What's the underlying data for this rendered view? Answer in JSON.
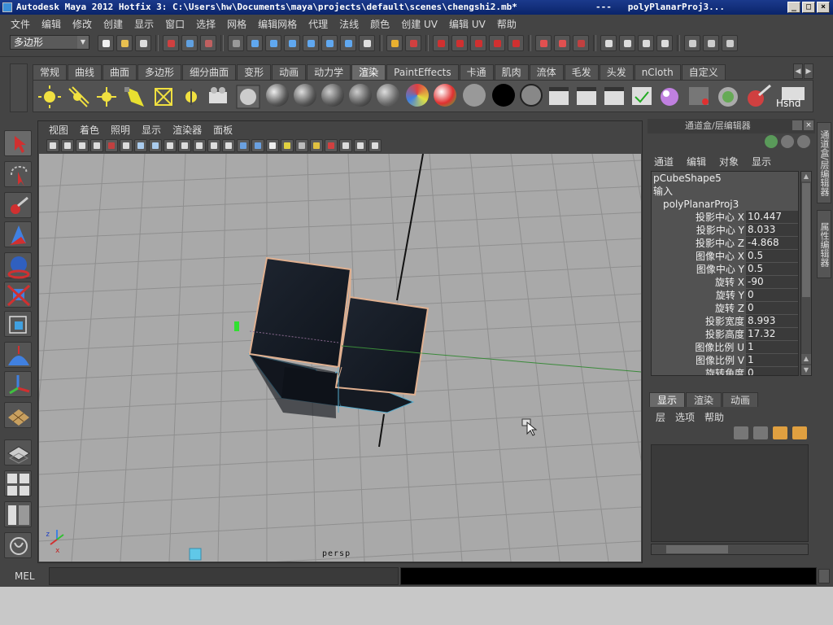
{
  "window": {
    "title": "Autodesk Maya 2012 Hotfix 3: C:\\Users\\hw\\Documents\\maya\\projects\\default\\scenes\\chengshi2.mb*   ---   polyPlanarProj3...",
    "title_left": "Autodesk Maya 2012 Hotfix 3: C:\\Users\\hw\\Documents\\maya\\projects\\default\\scenes\\chengshi2.mb*",
    "title_sep": "---",
    "title_right": "polyPlanarProj3..."
  },
  "menubar": [
    "文件",
    "编辑",
    "修改",
    "创建",
    "显示",
    "窗口",
    "选择",
    "网格",
    "编辑网格",
    "代理",
    "法线",
    "颜色",
    "创建 UV",
    "编辑 UV",
    "帮助"
  ],
  "status": {
    "mode": "多边形"
  },
  "shelf": {
    "tabs": [
      "常规",
      "曲线",
      "曲面",
      "多边形",
      "细分曲面",
      "变形",
      "动画",
      "动力学",
      "渲染",
      "PaintEffects",
      "卡通",
      "肌肉",
      "流体",
      "毛发",
      "头发",
      "nCloth",
      "自定义"
    ],
    "active_tab": "渲染",
    "last_item_label": "Hshd"
  },
  "panel": {
    "menu": [
      "视图",
      "着色",
      "照明",
      "显示",
      "渲染器",
      "面板"
    ],
    "camera_label": "persp"
  },
  "channel_box": {
    "header": "通道盒/层编辑器",
    "menu": [
      "通道",
      "编辑",
      "对象",
      "显示"
    ],
    "shape": "pCubeShape5",
    "inputs_label": "输入",
    "node": "polyPlanarProj3",
    "attributes": [
      {
        "label": "投影中心 X",
        "value": "10.447"
      },
      {
        "label": "投影中心 Y",
        "value": "8.033"
      },
      {
        "label": "投影中心 Z",
        "value": "-4.868"
      },
      {
        "label": "图像中心 X",
        "value": "0.5"
      },
      {
        "label": "图像中心 Y",
        "value": "0.5"
      },
      {
        "label": "旋转 X",
        "value": "-90"
      },
      {
        "label": "旋转 Y",
        "value": "0"
      },
      {
        "label": "旋转 Z",
        "value": "0"
      },
      {
        "label": "投影宽度",
        "value": "8.993"
      },
      {
        "label": "投影高度",
        "value": "17.32"
      },
      {
        "label": "图像比例 U",
        "value": "1"
      },
      {
        "label": "图像比例 V",
        "value": "1"
      },
      {
        "label": "旋转角度",
        "value": "0"
      }
    ]
  },
  "side_tabs": [
    "通道盒/层编辑器",
    "属性编辑器"
  ],
  "layer_editor": {
    "tabs": [
      "显示",
      "渲染",
      "动画"
    ],
    "active_tab": "显示",
    "menu": [
      "层",
      "选项",
      "帮助"
    ]
  },
  "command_line": {
    "label": "MEL"
  }
}
